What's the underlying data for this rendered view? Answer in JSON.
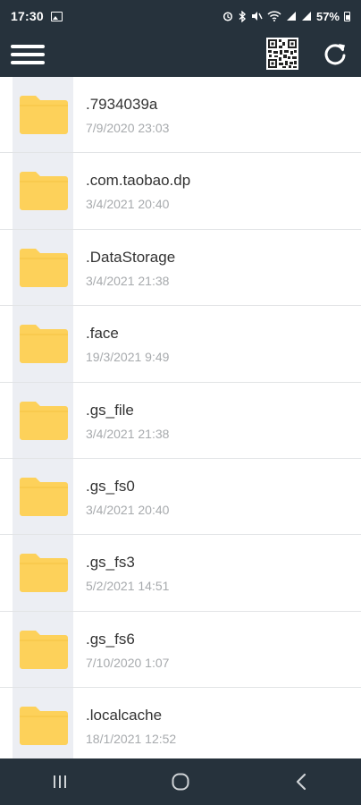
{
  "status_bar": {
    "time": "17:30",
    "battery": "57%"
  },
  "app_bar": {
    "menu_icon": "hamburger-menu-icon",
    "qr_icon": "qr-code-icon",
    "refresh_icon": "refresh-icon"
  },
  "colors": {
    "bar_background": "#26323c",
    "folder_yellow": "#fdd15a",
    "thumb_background": "#eceef3",
    "name_text": "#333333",
    "date_text": "#a7aaad"
  },
  "files": [
    {
      "name": ".7934039a",
      "date": "7/9/2020 23:03"
    },
    {
      "name": ".com.taobao.dp",
      "date": "3/4/2021 20:40"
    },
    {
      "name": ".DataStorage",
      "date": "3/4/2021 21:38"
    },
    {
      "name": ".face",
      "date": "19/3/2021 9:49"
    },
    {
      "name": ".gs_file",
      "date": "3/4/2021 21:38"
    },
    {
      "name": ".gs_fs0",
      "date": "3/4/2021 20:40"
    },
    {
      "name": ".gs_fs3",
      "date": "5/2/2021 14:51"
    },
    {
      "name": ".gs_fs6",
      "date": "7/10/2020 1:07"
    },
    {
      "name": ".localcache",
      "date": "18/1/2021 12:52"
    }
  ],
  "nav_bar": {
    "recents_icon": "recent-apps-icon",
    "home_icon": "home-icon",
    "back_icon": "back-icon"
  }
}
